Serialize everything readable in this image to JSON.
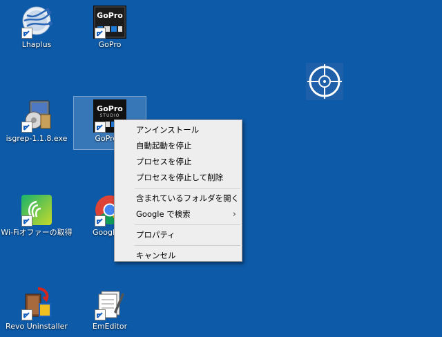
{
  "desktop": {
    "icons": [
      {
        "label": "Lhaplus"
      },
      {
        "label": "GoPro"
      },
      {
        "label": "isgrep-1.1.8.exe"
      },
      {
        "label": "GoPro S"
      },
      {
        "label": "Wi-Fiオファーの取得"
      },
      {
        "label": "Google C"
      },
      {
        "label": "Revo Uninstaller"
      },
      {
        "label": "EmEditor"
      }
    ],
    "gopro_brand": "GoPro",
    "gopro_studio_sub": "STUDIO"
  },
  "context_menu": {
    "items": [
      {
        "label": "アンインストール"
      },
      {
        "label": "自動起動を停止"
      },
      {
        "label": "プロセスを停止"
      },
      {
        "label": "プロセスを停止して削除"
      },
      {
        "label": "含まれているフォルダを開く"
      },
      {
        "label": "Google で検索",
        "submenu_arrow": "›"
      },
      {
        "label": "プロパティ"
      },
      {
        "label": "キャンセル"
      }
    ]
  },
  "colors": {
    "desktop_bg": "#0d5aa8",
    "menu_bg": "#eeeeee"
  }
}
